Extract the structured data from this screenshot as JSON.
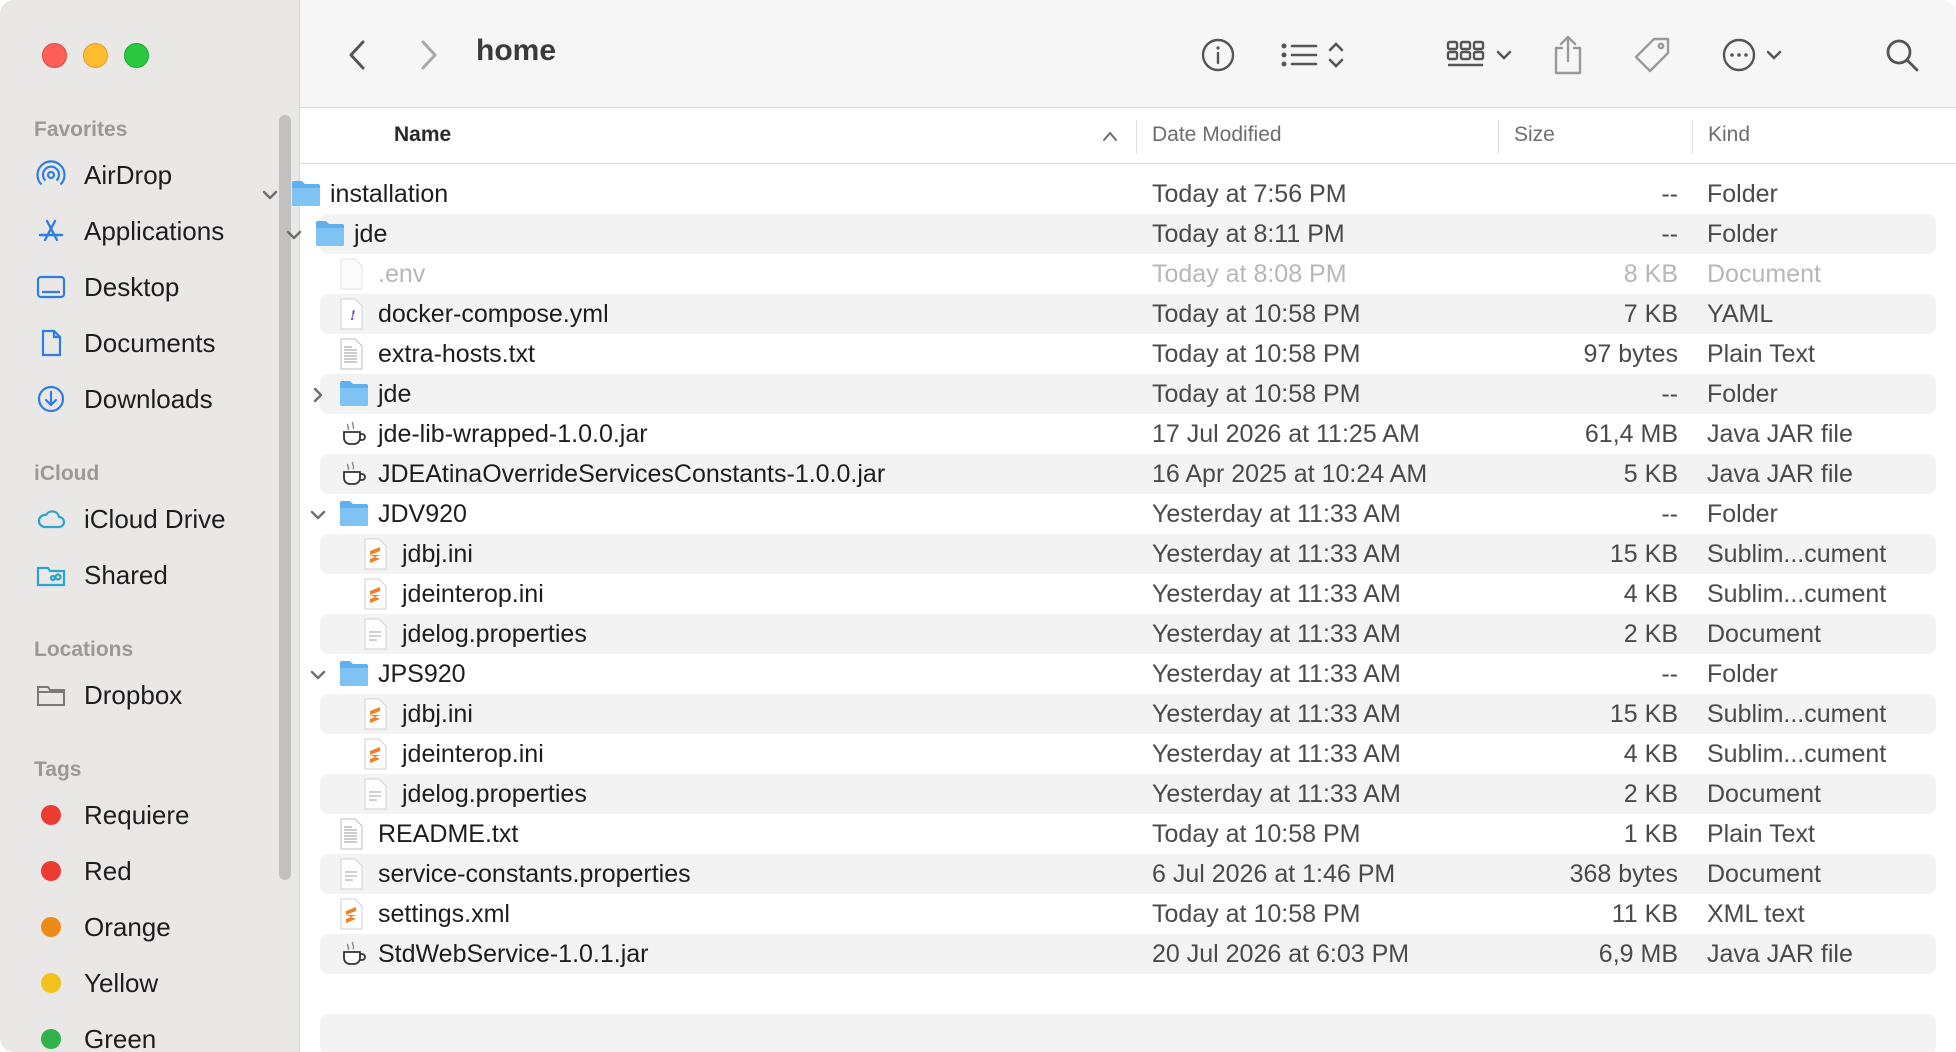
{
  "window": {
    "title": "home"
  },
  "sidebar": {
    "sections": [
      {
        "label": "Favorites",
        "items": [
          {
            "label": "AirDrop",
            "icon": "airdrop-icon"
          },
          {
            "label": "Applications",
            "icon": "applications-icon"
          },
          {
            "label": "Desktop",
            "icon": "desktop-icon"
          },
          {
            "label": "Documents",
            "icon": "document-icon"
          },
          {
            "label": "Downloads",
            "icon": "download-icon"
          }
        ]
      },
      {
        "label": "iCloud",
        "items": [
          {
            "label": "iCloud Drive",
            "icon": "cloud-icon"
          },
          {
            "label": "Shared",
            "icon": "shared-folder-icon"
          }
        ]
      },
      {
        "label": "Locations",
        "items": [
          {
            "label": "Dropbox",
            "icon": "folder-icon"
          }
        ]
      },
      {
        "label": "Tags",
        "items": [
          {
            "label": "Requiere",
            "color": "#ec3b31"
          },
          {
            "label": "Red",
            "color": "#ec3b31"
          },
          {
            "label": "Orange",
            "color": "#f08a16"
          },
          {
            "label": "Yellow",
            "color": "#f3c11c"
          },
          {
            "label": "Green",
            "color": "#2fb34a"
          }
        ]
      }
    ]
  },
  "columns": {
    "name": "Name",
    "date": "Date Modified",
    "size": "Size",
    "kind": "Kind"
  },
  "rows": [
    {
      "name": "installation",
      "date": "Today at 7:56 PM",
      "size": "--",
      "kind": "Folder",
      "level": 0,
      "type": "folder",
      "disclosure": "open"
    },
    {
      "name": "jde",
      "date": "Today at 8:11 PM",
      "size": "--",
      "kind": "Folder",
      "level": 1,
      "type": "folder",
      "disclosure": "open"
    },
    {
      "name": ".env",
      "date": "Today at 8:08 PM",
      "size": "8 KB",
      "kind": "Document",
      "level": 2,
      "type": "blank",
      "dim": true
    },
    {
      "name": "docker-compose.yml",
      "date": "Today at 10:58 PM",
      "size": "7 KB",
      "kind": "YAML",
      "level": 2,
      "type": "yaml"
    },
    {
      "name": "extra-hosts.txt",
      "date": "Today at 10:58 PM",
      "size": "97 bytes",
      "kind": "Plain Text",
      "level": 2,
      "type": "text"
    },
    {
      "name": "jde",
      "date": "Today at 10:58 PM",
      "size": "--",
      "kind": "Folder",
      "level": 2,
      "type": "folder",
      "disclosure": "closed"
    },
    {
      "name": "jde-lib-wrapped-1.0.0.jar",
      "date": "17 Jul 2026 at 11:25 AM",
      "size": "61,4 MB",
      "kind": "Java JAR file",
      "level": 2,
      "type": "jar"
    },
    {
      "name": "JDEAtinaOverrideServicesConstants-1.0.0.jar",
      "date": "16 Apr 2025 at 10:24 AM",
      "size": "5 KB",
      "kind": "Java JAR file",
      "level": 2,
      "type": "jar"
    },
    {
      "name": "JDV920",
      "date": "Yesterday at 11:33 AM",
      "size": "--",
      "kind": "Folder",
      "level": 2,
      "type": "folder",
      "disclosure": "open"
    },
    {
      "name": "jdbj.ini",
      "date": "Yesterday at 11:33 AM",
      "size": "15 KB",
      "kind": "Sublim...cument",
      "level": 3,
      "type": "sublime"
    },
    {
      "name": "jdeinterop.ini",
      "date": "Yesterday at 11:33 AM",
      "size": "4 KB",
      "kind": "Sublim...cument",
      "level": 3,
      "type": "sublime"
    },
    {
      "name": "jdelog.properties",
      "date": "Yesterday at 11:33 AM",
      "size": "2 KB",
      "kind": "Document",
      "level": 3,
      "type": "doc"
    },
    {
      "name": "JPS920",
      "date": "Yesterday at 11:33 AM",
      "size": "--",
      "kind": "Folder",
      "level": 2,
      "type": "folder",
      "disclosure": "open"
    },
    {
      "name": "jdbj.ini",
      "date": "Yesterday at 11:33 AM",
      "size": "15 KB",
      "kind": "Sublim...cument",
      "level": 3,
      "type": "sublime"
    },
    {
      "name": "jdeinterop.ini",
      "date": "Yesterday at 11:33 AM",
      "size": "4 KB",
      "kind": "Sublim...cument",
      "level": 3,
      "type": "sublime"
    },
    {
      "name": "jdelog.properties",
      "date": "Yesterday at 11:33 AM",
      "size": "2 KB",
      "kind": "Document",
      "level": 3,
      "type": "doc"
    },
    {
      "name": "README.txt",
      "date": "Today at 10:58 PM",
      "size": "1 KB",
      "kind": "Plain Text",
      "level": 2,
      "type": "text"
    },
    {
      "name": "service-constants.properties",
      "date": "6 Jul 2026 at 1:46 PM",
      "size": "368 bytes",
      "kind": "Document",
      "level": 2,
      "type": "doc"
    },
    {
      "name": "settings.xml",
      "date": "Today at 10:58 PM",
      "size": "11 KB",
      "kind": "XML text",
      "level": 2,
      "type": "sublime"
    },
    {
      "name": "StdWebService-1.0.1.jar",
      "date": "20 Jul 2026 at 6:03 PM",
      "size": "6,9 MB",
      "kind": "Java JAR file",
      "level": 2,
      "type": "jar"
    }
  ]
}
